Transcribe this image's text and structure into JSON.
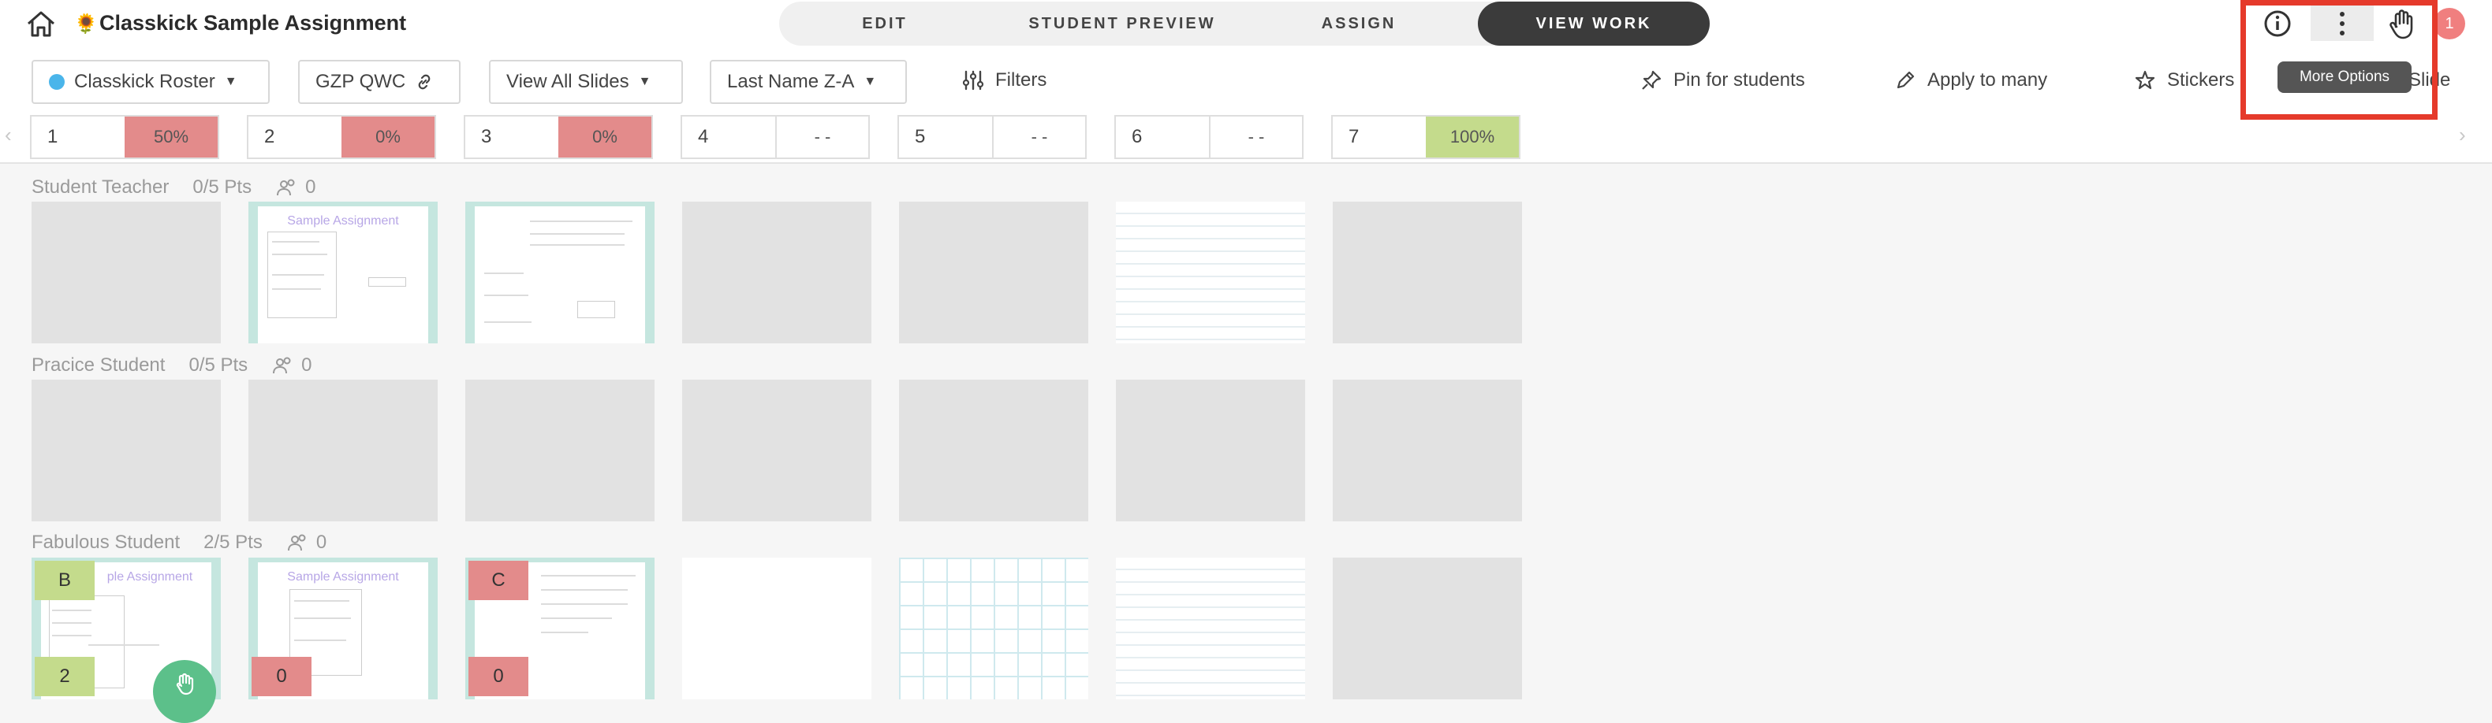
{
  "header": {
    "title": "Classkick Sample Assignment",
    "title_icon": "sunflower-icon",
    "tabs": [
      {
        "label": "EDIT",
        "active": false
      },
      {
        "label": "STUDENT PREVIEW",
        "active": false
      },
      {
        "label": "ASSIGN",
        "active": false
      },
      {
        "label": "VIEW WORK",
        "active": true
      }
    ],
    "notification_count": "1",
    "tooltip": "More Options",
    "right_icons": [
      "info-icon",
      "more-options-icon",
      "hand-icon"
    ]
  },
  "toolbar": {
    "roster": "Classkick Roster",
    "class_code": "GZP QWC",
    "slides_filter": "View All Slides",
    "sort": "Last Name Z-A",
    "filters": "Filters",
    "pin": "Pin for students",
    "apply": "Apply to many",
    "stickers": "Stickers",
    "slide_fragment": "Slide"
  },
  "slides": [
    {
      "num": "1",
      "pct": "50%",
      "status": "red"
    },
    {
      "num": "2",
      "pct": "0%",
      "status": "red"
    },
    {
      "num": "3",
      "pct": "0%",
      "status": "red"
    },
    {
      "num": "4",
      "pct": "- -",
      "status": "none"
    },
    {
      "num": "5",
      "pct": "- -",
      "status": "none"
    },
    {
      "num": "6",
      "pct": "- -",
      "status": "none"
    },
    {
      "num": "7",
      "pct": "100%",
      "status": "green"
    }
  ],
  "students": [
    {
      "name": "Student Teacher",
      "points": "0/5 Pts",
      "helpers": "0"
    },
    {
      "name": "Pracice Student",
      "points": "0/5 Pts",
      "helpers": "0"
    },
    {
      "name": "Fabulous Student",
      "points": "2/5 Pts",
      "helpers": "0"
    }
  ],
  "thumb_text": {
    "sample_title": "Sample Assignment",
    "sample_title_cut": "ple Assignment"
  },
  "grades": {
    "s3_slide1_top": "B",
    "s3_slide1_bottom": "2",
    "s3_slide2_bottom": "0",
    "s3_slide3_top": "C",
    "s3_slide3_bottom": "0"
  },
  "colors": {
    "accent_dark": "#3b3b3b",
    "highlight_red": "#e53a2b",
    "status_red": "#e38b8b",
    "status_green": "#c4db8c",
    "roster_blue": "#4ab5ea"
  }
}
